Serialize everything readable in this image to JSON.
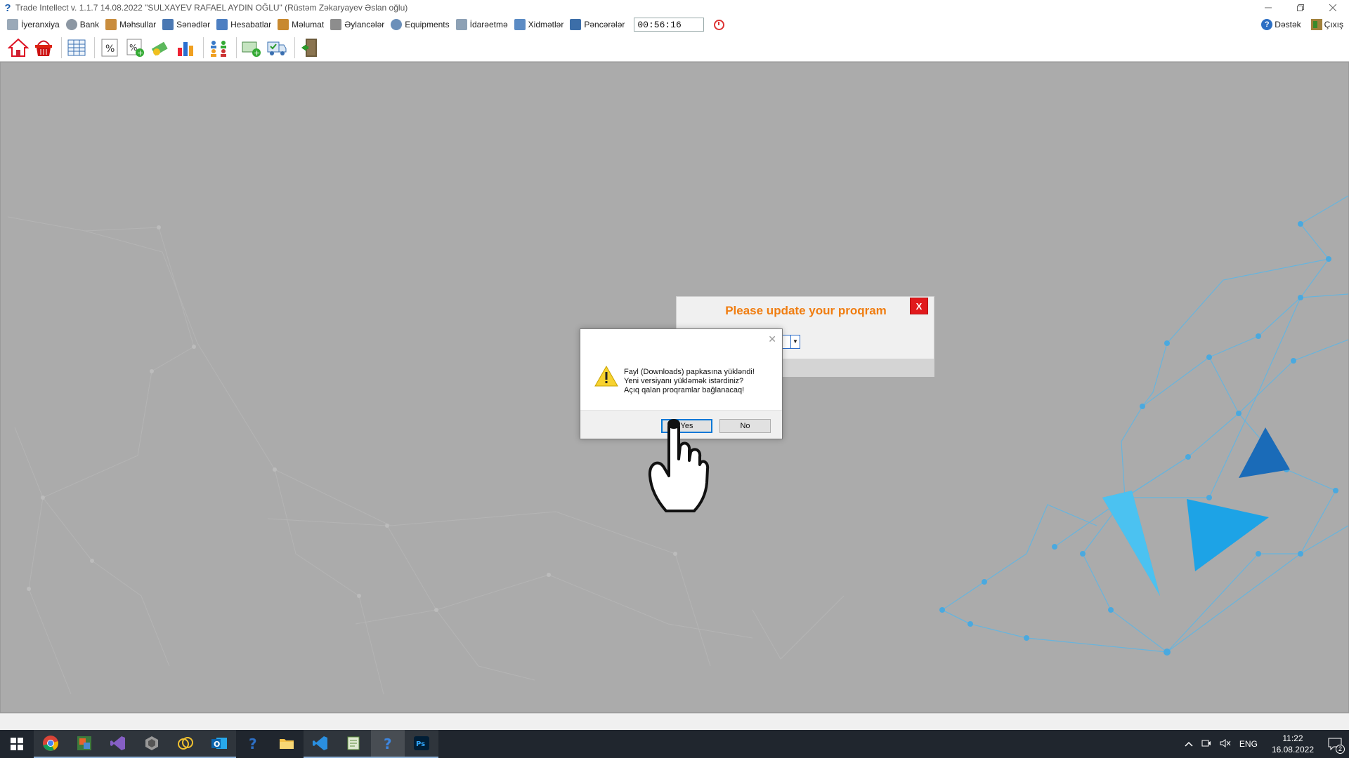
{
  "window": {
    "title": "Trade Intellect v. 1.1.7 14.08.2022 \"SULXAYEV RAFAEL AYDIN OĞLU\"  (Rüstəm Zəkaryayev Əslan oğlu)",
    "controls": [
      "minimize-icon",
      "restore-icon",
      "close-icon"
    ]
  },
  "menu": {
    "items": [
      {
        "label": "İyeranxiya",
        "icon": "hierarchy-icon",
        "color": "#9aa9b8"
      },
      {
        "label": "Bank",
        "icon": "bank-icon",
        "color": "#8c97a3"
      },
      {
        "label": "Məhsullar",
        "icon": "products-icon",
        "color": "#c98d3e"
      },
      {
        "label": "Sənədlər",
        "icon": "documents-icon",
        "color": "#4a78b3"
      },
      {
        "label": "Hesabatlar",
        "icon": "reports-icon",
        "color": "#4d7fc2"
      },
      {
        "label": "Məlumat",
        "icon": "info-icon",
        "color": "#c8892f"
      },
      {
        "label": "Əylancələr",
        "icon": "games-icon",
        "color": "#8d8d8d"
      },
      {
        "label": "Equipments",
        "icon": "equipment-icon",
        "color": "#6b8fb9"
      },
      {
        "label": "İdarəetmə",
        "icon": "management-icon",
        "color": "#8da1b5"
      },
      {
        "label": "Xidmətlər",
        "icon": "services-icon",
        "color": "#5b8bc4"
      },
      {
        "label": "Pəncərələr",
        "icon": "windows-icon",
        "color": "#3c6ea8"
      }
    ],
    "clock": "00:56:16",
    "right": {
      "support": "Dəstək",
      "exit": "Çıxış"
    }
  },
  "toolbar": {
    "buttons": [
      "home-icon",
      "basket-icon",
      "grid-icon",
      "percent-icon",
      "percent-add-icon",
      "money-icon",
      "chart-icon",
      "users-icon",
      "cash-add-icon",
      "truck-icon",
      "exit-door-icon"
    ]
  },
  "update_dialog": {
    "title": "Please update your proqram",
    "close": "X"
  },
  "msgbox": {
    "close": "✕",
    "lines": [
      "Fayl (Downloads) papkasına yükləndi!",
      "Yeni versiyanı yükləmək istərdiniz?",
      "Açıq qalan proqramlar bağlanacaq!"
    ],
    "yes": "Yes",
    "no": "No"
  },
  "taskbar": {
    "apps": [
      "chrome-icon",
      "app-icon",
      "visual-studio-icon",
      "toolbox-icon",
      "sync-icon",
      "outlook-icon",
      "help-icon",
      "file-explorer-icon",
      "vscode-icon",
      "notepad-icon",
      "help-icon-active",
      "photoshop-icon"
    ],
    "tray_lang": "ENG",
    "time": "11:22",
    "date": "16.08.2022",
    "notifications": "2"
  },
  "colors": {
    "accent_orange": "#f07d10",
    "close_red": "#e1191c",
    "taskbar": "#20262e",
    "workspace": "#ababab"
  }
}
